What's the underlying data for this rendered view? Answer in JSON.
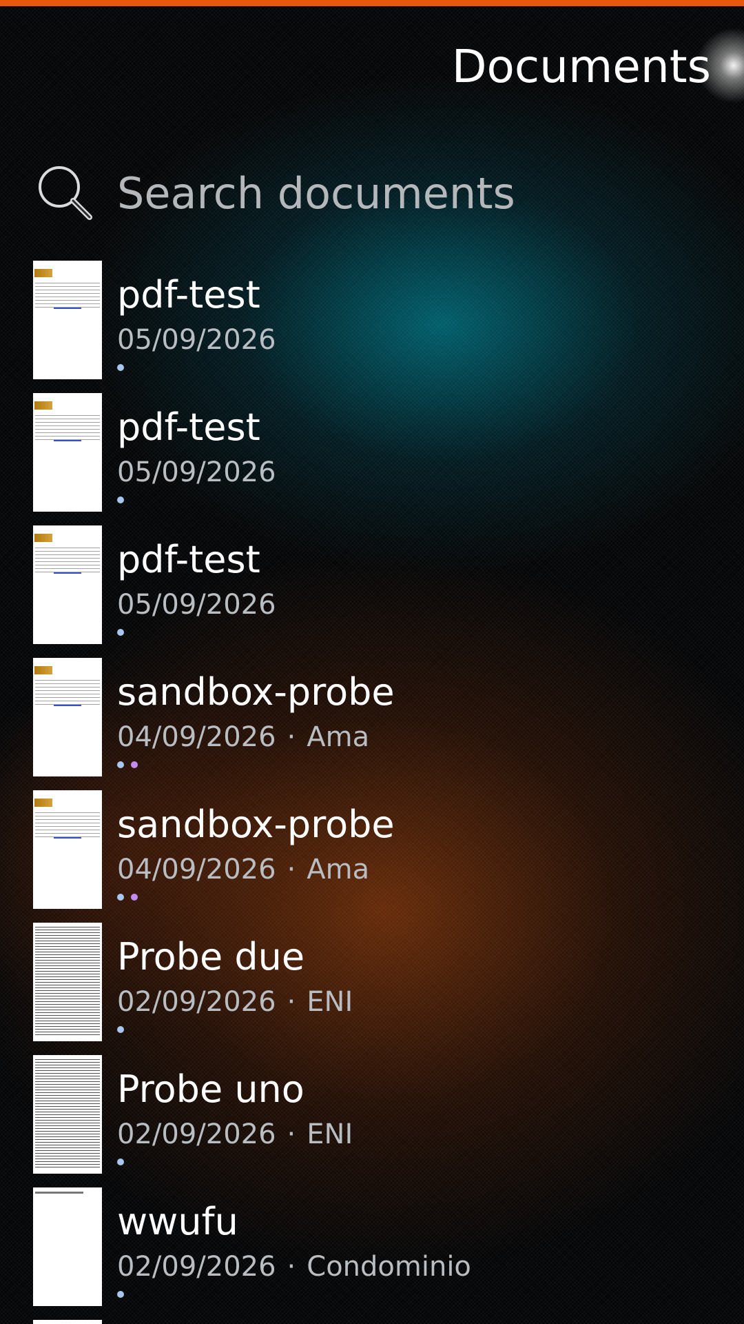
{
  "header": {
    "title": "Documents"
  },
  "search": {
    "placeholder": "Search documents",
    "icon": "search-icon"
  },
  "colors": {
    "accent_bar": "#e8580c",
    "dot_blue": "#a9c6ee",
    "dot_purple": "#c58cf0"
  },
  "documents": [
    {
      "title": "pdf-test",
      "date": "05/09/2026",
      "tag": "",
      "thumb": "letter",
      "dots": [
        "#a9c6ee"
      ]
    },
    {
      "title": "pdf-test",
      "date": "05/09/2026",
      "tag": "",
      "thumb": "letter",
      "dots": [
        "#a9c6ee"
      ]
    },
    {
      "title": "pdf-test",
      "date": "05/09/2026",
      "tag": "",
      "thumb": "letter",
      "dots": [
        "#a9c6ee"
      ]
    },
    {
      "title": "sandbox-probe",
      "date": "04/09/2026",
      "tag": "Ama",
      "thumb": "letter",
      "dots": [
        "#a9c6ee",
        "#c58cf0"
      ]
    },
    {
      "title": "sandbox-probe",
      "date": "04/09/2026",
      "tag": "Ama",
      "thumb": "letter",
      "dots": [
        "#a9c6ee",
        "#c58cf0"
      ]
    },
    {
      "title": "Probe due",
      "date": "02/09/2026",
      "tag": "ENI",
      "thumb": "dense",
      "dots": [
        "#a9c6ee"
      ]
    },
    {
      "title": "Probe uno",
      "date": "02/09/2026",
      "tag": "ENI",
      "thumb": "dense",
      "dots": [
        "#a9c6ee"
      ]
    },
    {
      "title": "wwufu",
      "date": "02/09/2026",
      "tag": "Condominio",
      "thumb": "blank",
      "dots": [
        "#a9c6ee"
      ]
    }
  ]
}
